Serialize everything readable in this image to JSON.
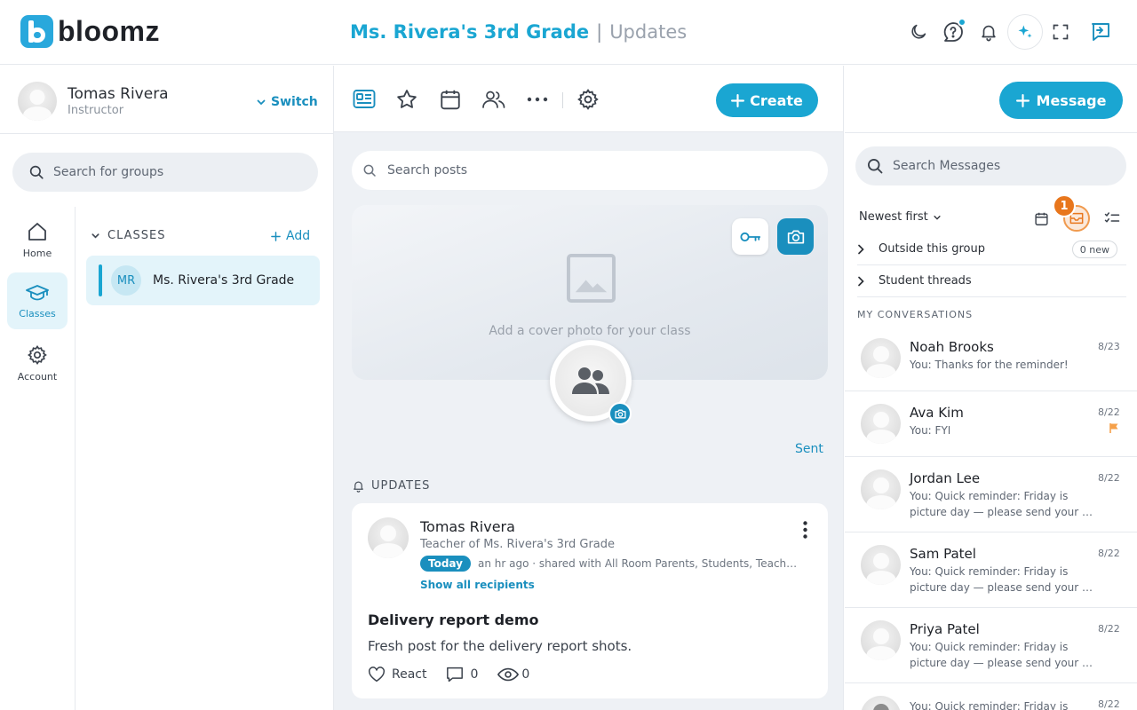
{
  "app": {
    "name": "bloomz"
  },
  "header": {
    "group": "Ms. Rivera's 3rd Grade",
    "separator": "|",
    "page": "Updates"
  },
  "profile": {
    "name": "Tomas Rivera",
    "role": "Instructor",
    "switch_label": "Switch"
  },
  "sidebar": {
    "search_placeholder": "Search for groups",
    "nav": [
      {
        "label": "Home"
      },
      {
        "label": "Classes"
      },
      {
        "label": "Account"
      }
    ],
    "classes_heading": "CLASSES",
    "add_label": "Add",
    "class_item": {
      "initials": "MR",
      "name": "Ms. Rivera's 3rd Grade"
    }
  },
  "center": {
    "create_label": "Create",
    "search_placeholder": "Search posts",
    "cover_label": "Add a cover photo for your class",
    "sent_label": "Sent",
    "updates_heading": "UPDATES",
    "post": {
      "author": "Tomas Rivera",
      "subtitle": "Teacher of Ms. Rivera's 3rd Grade",
      "badge": "Today",
      "meta": "an hr ago · shared with All Room Parents, Students, Teach…",
      "recipients_link": "Show all recipients",
      "title": "Delivery report demo",
      "body": "Fresh post for the delivery report shots.",
      "react_label": "React",
      "comments": "0",
      "views": "0"
    }
  },
  "messages": {
    "message_button": "Message",
    "search_placeholder": "Search Messages",
    "sort_label": "Newest first",
    "badge_count": "1",
    "outside_label": "Outside this group",
    "outside_pill": "0 new",
    "student_threads": "Student threads",
    "heading": "MY CONVERSATIONS",
    "conversations": [
      {
        "name": "Noah Brooks",
        "date": "8/23",
        "text": "You: Thanks for the reminder!"
      },
      {
        "name": "Ava Kim",
        "date": "8/22",
        "text": "You: FYI"
      },
      {
        "name": "Jordan Lee",
        "date": "8/22",
        "text": "You: Quick reminder: Friday is picture day — please send your …"
      },
      {
        "name": "Sam Patel",
        "date": "8/22",
        "text": "You: Quick reminder: Friday is picture day — please send your …"
      },
      {
        "name": "Priya Patel",
        "date": "8/22",
        "text": "You: Quick reminder: Friday is picture day — please send your …"
      },
      {
        "name": "",
        "date": "8/22",
        "text": "You: Quick reminder: Friday is"
      }
    ]
  },
  "colors": {
    "accent": "#1aa6d2",
    "accent_dark": "#1a8fbe",
    "badge_orange": "#e8761c",
    "flag": "#f5a04a"
  }
}
